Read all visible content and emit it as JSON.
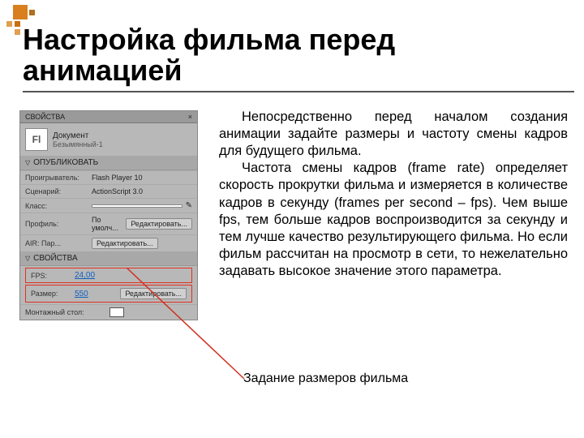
{
  "title_line1": "Настройка фильма перед",
  "title_line2": "анимацией",
  "body_p1": "Непосредственно перед началом создания анимации задайте размеры и частоту смены кадров для будущего фильма.",
  "body_p2": "Частота смены кадров (frame rate) определяет скорость прокрутки фильма и измеряется в количестве кадров в секунду (frames per second – fps). Чем выше fps, тем больше кадров воспроизводится за секунду и тем лучше качество результирующего фильма. Но если фильм рассчитан на просмотр в сети, то нежелательно задавать высокое значение этого параметра.",
  "caption": "Задание размеров фильма",
  "panel": {
    "tab": "СВОЙСТВА",
    "close": "×",
    "fl": "Fl",
    "doc_label": "Документ",
    "doc_name": "Безымянный-1",
    "publish": "ОПУБЛИКОВАТЬ",
    "player_label": "Проигрыватель:",
    "player_value": "Flash Player 10",
    "script_label": "Сценарий:",
    "script_value": "ActionScript 3.0",
    "class_label": "Класс:",
    "class_value": "",
    "pencil": "✎",
    "profile_label": "Профиль:",
    "profile_value": "По умолч...",
    "edit_btn": "Редактировать...",
    "air_label": "AIR: Пар...",
    "props": "СВОЙСТВА",
    "fps_label": "FPS:",
    "fps_value": "24,00",
    "size_label": "Размер:",
    "size_value": "550",
    "stage_label": "Монтажный стол:"
  }
}
